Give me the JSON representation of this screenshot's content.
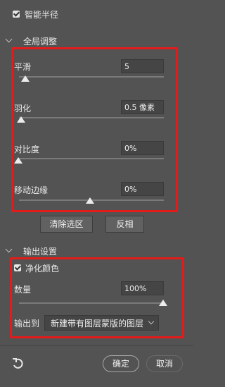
{
  "smart_radius": {
    "label": "智能半径",
    "checked": true
  },
  "global": {
    "title": "全局调整",
    "smooth": {
      "label": "平滑",
      "value": "5",
      "level": 0.05
    },
    "feather": {
      "label": "羽化",
      "value": "0.5 像素",
      "level": 0.02
    },
    "contrast": {
      "label": "对比度",
      "value": "0%",
      "level": 0.0
    },
    "shift_edge": {
      "label": "移动边缘",
      "value": "0%",
      "level": 0.5
    },
    "clear_selection": "清除选区",
    "invert": "反相"
  },
  "output": {
    "title": "输出设置",
    "decontaminate": {
      "label": "净化颜色",
      "checked": true
    },
    "amount": {
      "label": "数量",
      "value": "100%",
      "level": 1.0
    },
    "output_to_label": "输出到",
    "output_to_value": "新建带有图层蒙版的图层"
  },
  "footer": {
    "ok": "确定",
    "cancel": "取消"
  },
  "colors": {
    "highlight": "#e31b1b",
    "panel": "#535353"
  },
  "icons": {
    "reset": "reset-arrow-icon"
  }
}
